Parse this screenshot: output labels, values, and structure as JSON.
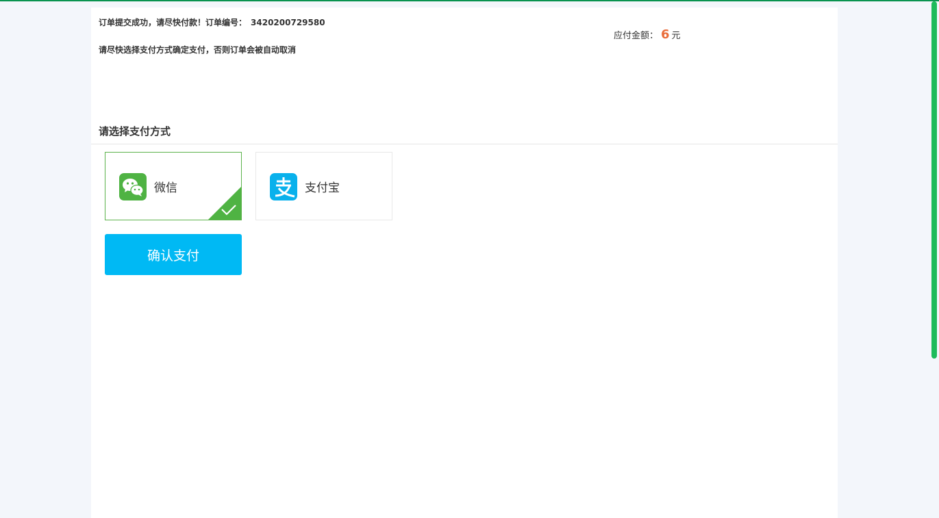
{
  "order": {
    "success_text": "订单提交成功，请尽快付款！订单编号：",
    "order_number": "3420200729580",
    "notice": "请尽快选择支付方式确定支付，否则订单会被自动取消"
  },
  "amount": {
    "label": "应付金额：",
    "value": "6",
    "unit": "元"
  },
  "payment": {
    "section_title": "请选择支付方式",
    "options": [
      {
        "label": "微信",
        "icon": "wechat-icon",
        "selected": true
      },
      {
        "label": "支付宝",
        "icon": "alipay-icon",
        "selected": false
      }
    ],
    "confirm_label": "确认支付"
  },
  "colors": {
    "accent_blue": "#00b9f4",
    "wechat_green": "#4fb343",
    "alipay_blue": "#09b1ec",
    "amount_orange": "#e96d3b",
    "top_line": "#09934f"
  }
}
